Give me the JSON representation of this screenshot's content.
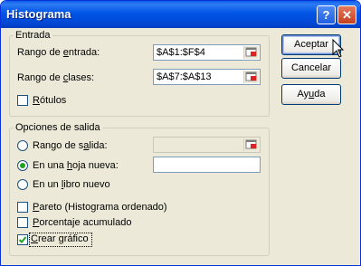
{
  "window": {
    "title": "Histograma"
  },
  "titlebar": {
    "help_glyph": "?",
    "close_glyph": "✕"
  },
  "entrada": {
    "legend": "Entrada",
    "rango_entrada_label": "Rango de ",
    "rango_entrada_label_u": "e",
    "rango_entrada_label_rest": "ntrada:",
    "rango_entrada_value": "$A$1:$F$4",
    "rango_clases_label": "Rango de ",
    "rango_clases_label_u": "c",
    "rango_clases_label_rest": "lases:",
    "rango_clases_value": "$A$7:$A$13",
    "rotulos_u": "R",
    "rotulos_rest": "ótulos",
    "rotulos_checked": false
  },
  "salida": {
    "legend": "Opciones de salida",
    "rango_salida_u": "Rango de s",
    "rango_salida_u2": "a",
    "rango_salida_rest": "lida:",
    "hoja_nueva_pre": "En una ",
    "hoja_nueva_u": "h",
    "hoja_nueva_rest": "oja nueva:",
    "libro_nuevo_pre": "En un ",
    "libro_nuevo_u": "l",
    "libro_nuevo_rest": "ibro nuevo",
    "selected": "hoja_nueva",
    "pareto_u": "P",
    "pareto_rest": "areto (Histograma ordenado)",
    "pareto_checked": false,
    "porcentaje_u": "P",
    "porcentaje_rest": "orcentaje acumulado",
    "porcentaje_checked": false,
    "grafico_u": "C",
    "grafico_rest": "rear gráfico",
    "grafico_checked": true
  },
  "buttons": {
    "aceptar": "Aceptar",
    "cancelar": "Cancelar",
    "ayuda_pre": "Ay",
    "ayuda_u": "u",
    "ayuda_rest": "da"
  },
  "colors": {
    "title_bar": "#0055e5",
    "dialog_bg": "#ece9d8",
    "radio_dot": "#21a121"
  }
}
